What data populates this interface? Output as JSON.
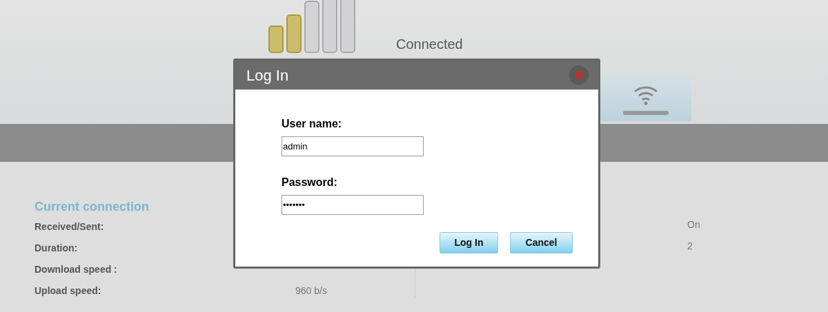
{
  "header": {
    "status": "Connected"
  },
  "current_connection": {
    "title": "Current connection",
    "rows": [
      {
        "label": "Received/Sent:"
      },
      {
        "label": "Duration:"
      },
      {
        "label": "Download speed :"
      },
      {
        "label": "Upload speed:",
        "value": "960 b/s"
      }
    ]
  },
  "right_values": [
    "On",
    "2"
  ],
  "dialog": {
    "title": "Log In",
    "fields": [
      {
        "label": "User name:",
        "value": "admin"
      },
      {
        "label": "Password:",
        "value": "•••••••"
      }
    ],
    "buttons": [
      "Log In",
      "Cancel"
    ]
  }
}
